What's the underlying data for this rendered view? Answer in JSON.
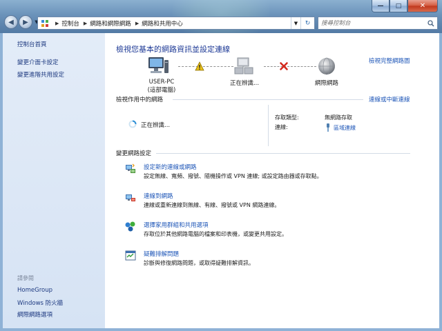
{
  "window": {
    "minimize": "—",
    "maximize": "□",
    "close": "✕"
  },
  "address": {
    "crumbs": [
      "控制台",
      "網路和網際網路",
      "網路和共用中心"
    ]
  },
  "search": {
    "placeholder": "搜尋控制台"
  },
  "sidebar": {
    "home": "控制台首頁",
    "links": [
      "變更介面卡設定",
      "變更進階共用設定"
    ],
    "see_also_caption": "請參閱",
    "see_also": [
      "HomeGroup",
      "Windows 防火牆",
      "網際網路選項"
    ]
  },
  "main": {
    "title": "檢視您基本的網路資訊並設定連線",
    "see_full_map": "檢視完整網路圖",
    "map": {
      "computer_name": "USER-PC",
      "computer_sub": "(這部電腦)",
      "middle_label": "正在辨識...",
      "internet_label": "網際網路"
    },
    "active_section": "檢視作用中的網路",
    "connect_disconnect": "連線或中斷連線",
    "active": {
      "status": "正在辨識...",
      "access_type_label": "存取類型:",
      "access_type_value": "無網路存取",
      "connection_label": "連線:",
      "connection_value": "區域連線"
    },
    "change_section": "變更網路設定",
    "tasks": [
      {
        "title": "設定新的連線或網路",
        "desc": "設定無線、寬頻、撥號、隨機操作或 VPN 連線; 或設定路由器或存取點。"
      },
      {
        "title": "連線到網路",
        "desc": "連線或重新連線到無線、有線、撥號或 VPN 網路連線。"
      },
      {
        "title": "選擇家用群組和共用選項",
        "desc": "存取位於其他網路電腦的檔案和印表機，或變更共用設定。"
      },
      {
        "title": "疑難排解問題",
        "desc": "診斷與修復網路問題，或取得疑難排解資訊。"
      }
    ]
  },
  "colors": {
    "link": "#1f57b8",
    "title": "#1e3a96",
    "warning": "#e8c01a",
    "error": "#d42a1e"
  }
}
